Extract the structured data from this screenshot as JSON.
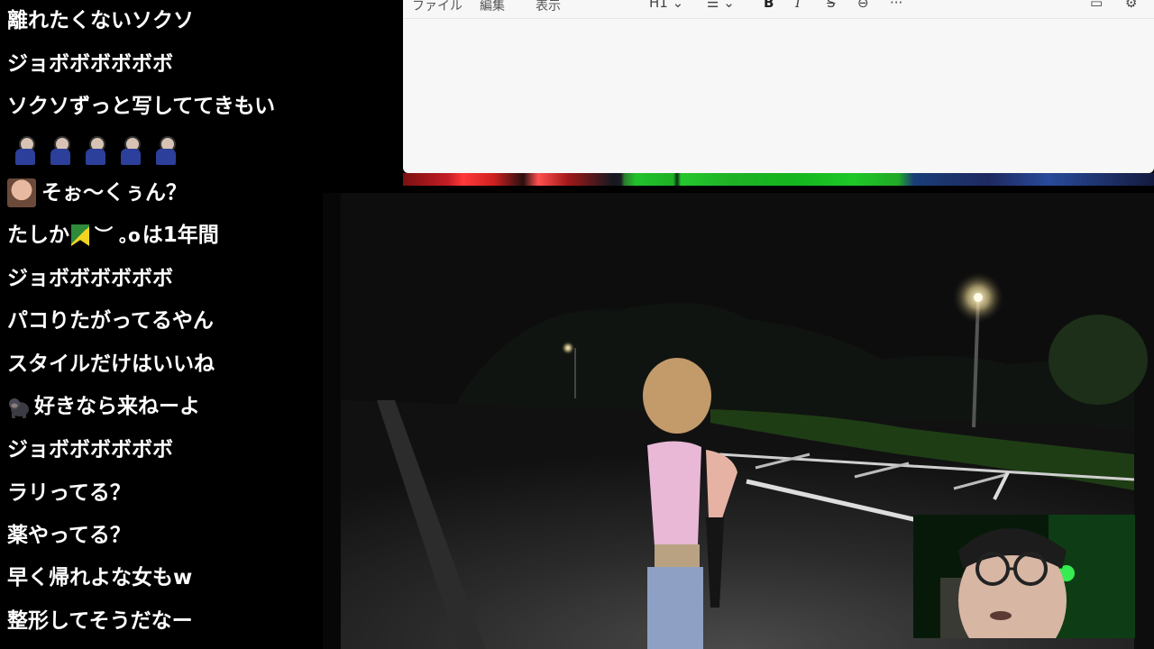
{
  "chat": {
    "messages": [
      {
        "text": "離れたくないソクソ"
      },
      {
        "text": "ジョボボボボボボ"
      },
      {
        "text": "ソクソずっと写しててきもい"
      },
      {
        "text": ""
      },
      {
        "text": "そぉ～くぅん？"
      },
      {
        "text_before": "たしか",
        "face": "︶ ｡o",
        "text": "は1年間"
      },
      {
        "text": "ジョボボボボボボ"
      },
      {
        "text": "パコりたがってるやん"
      },
      {
        "text": "スタイルだけはいいね"
      },
      {
        "text": "好きなら来ねーよ"
      },
      {
        "text": "ジョボボボボボボ"
      },
      {
        "text": "ラリってる？"
      },
      {
        "text": "薬やってる？"
      },
      {
        "text": "早く帰れよな女もw"
      },
      {
        "text": "整形してそうだなー"
      }
    ],
    "icons": {
      "stamp": "character-stamp-icon",
      "beginner": "beginner-mark-icon",
      "gorilla": "gorilla-icon",
      "avatar": "user-avatar"
    }
  },
  "editor": {
    "menu": [
      "ファイル",
      "編集",
      "表示"
    ],
    "heading_label": "H1",
    "toolbar_icons": [
      "list-icon",
      "bold-icon",
      "italic-icon",
      "strikethrough-icon",
      "link-icon",
      "more-icon",
      "comment-icon",
      "settings-icon"
    ],
    "bold_glyph": "B",
    "italic_glyph": "I",
    "strike_glyph": "S",
    "more_glyph": "···"
  },
  "colors": {
    "chat_text": "#ffffff",
    "editor_bg": "#f7f7f7",
    "video_bg": "#0a0a0a",
    "pip_green": "#1fd13a"
  }
}
